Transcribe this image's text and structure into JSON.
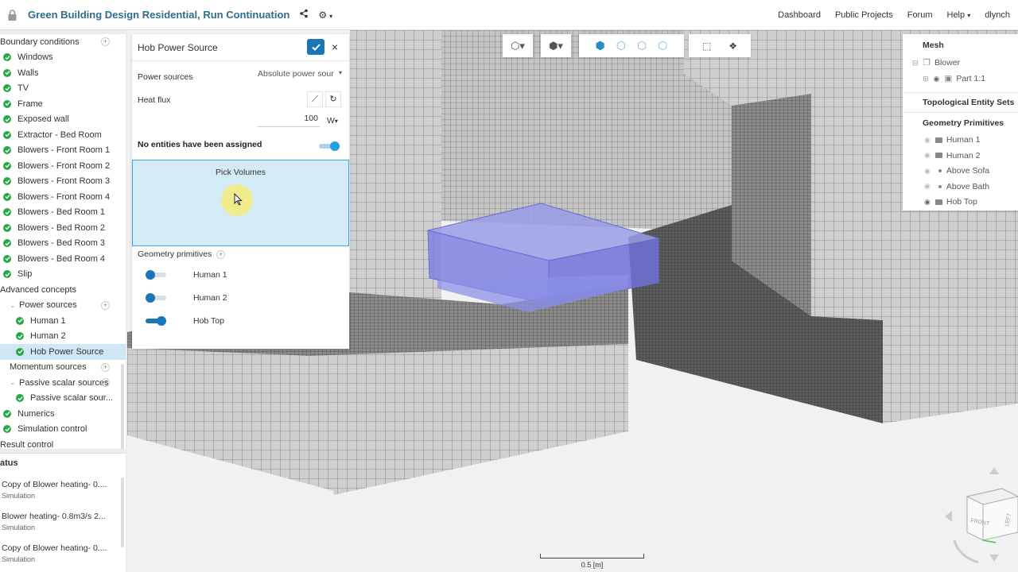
{
  "header": {
    "title": "Green Building Design Residential, Run Continuation",
    "nav": [
      "Dashboard",
      "Public Projects",
      "Forum",
      "Help",
      "dlynch"
    ]
  },
  "tree": [
    {
      "label": "Boundary conditions",
      "level": 0,
      "check": false,
      "plus": true
    },
    {
      "label": "Windows",
      "level": 1,
      "check": true
    },
    {
      "label": "Walls",
      "level": 1,
      "check": true
    },
    {
      "label": "TV",
      "level": 1,
      "check": true
    },
    {
      "label": "Frame",
      "level": 1,
      "check": true
    },
    {
      "label": "Exposed wall",
      "level": 1,
      "check": true
    },
    {
      "label": "Extractor - Bed Room",
      "level": 1,
      "check": true
    },
    {
      "label": "Blowers - Front Room 1",
      "level": 1,
      "check": true
    },
    {
      "label": "Blowers - Front Room 2",
      "level": 1,
      "check": true
    },
    {
      "label": "Blowers - Front Room 3",
      "level": 1,
      "check": true
    },
    {
      "label": "Blowers - Front Room 4",
      "level": 1,
      "check": true
    },
    {
      "label": "Blowers - Bed Room 1",
      "level": 1,
      "check": true
    },
    {
      "label": "Blowers - Bed Room 2",
      "level": 1,
      "check": true
    },
    {
      "label": "Blowers - Bed Room 3",
      "level": 1,
      "check": true
    },
    {
      "label": "Blowers - Bed Room 4",
      "level": 1,
      "check": true
    },
    {
      "label": "Slip",
      "level": 1,
      "check": true
    },
    {
      "label": "Advanced concepts",
      "level": 0,
      "check": false
    },
    {
      "label": "Power sources",
      "level": 2,
      "check": false,
      "plus": true,
      "expander": true
    },
    {
      "label": "Human 1",
      "level": 3,
      "check": true
    },
    {
      "label": "Human 2",
      "level": 3,
      "check": true
    },
    {
      "label": "Hob Power Source",
      "level": 3,
      "check": true,
      "selected": true
    },
    {
      "label": "Momentum sources",
      "level": 2,
      "check": false,
      "plus": true
    },
    {
      "label": "Passive scalar sources",
      "level": 2,
      "check": false,
      "plus": true,
      "expander": true
    },
    {
      "label": "Passive scalar sour...",
      "level": 3,
      "check": true
    },
    {
      "label": "Numerics",
      "level": 1,
      "check": true
    },
    {
      "label": "Simulation control",
      "level": 1,
      "check": true
    },
    {
      "label": "Result control",
      "level": 0,
      "check": false
    }
  ],
  "status": {
    "title": "atus",
    "jobs": [
      {
        "name": "Copy of Blower heating- 0....",
        "type": "Simulation"
      },
      {
        "name": "Blower heating- 0.8m3/s 2...",
        "type": "Simulation"
      },
      {
        "name": "Copy of Blower heating- 0....",
        "type": "Simulation"
      }
    ]
  },
  "panel": {
    "title": "Hob Power Source",
    "power_sources_label": "Power sources",
    "power_sources_value": "Absolute power sour",
    "heat_flux_label": "Heat flux",
    "heat_flux_value": "100",
    "heat_flux_unit": "W",
    "assignment_label": "No entities have been assigned",
    "assignment_toggle_on": true,
    "pick_label": "Pick Volumes",
    "geometry_primitives_label": "Geometry primitives",
    "primitives": [
      {
        "label": "Human 1",
        "on": false
      },
      {
        "label": "Human 2",
        "on": false
      },
      {
        "label": "Hob Top",
        "on": true
      }
    ]
  },
  "right_panel": {
    "mesh_title": "Mesh",
    "mesh_items": [
      {
        "label": "Blower"
      },
      {
        "label": "Part 1:1"
      }
    ],
    "topo_title": "Topological Entity Sets",
    "geo_title": "Geometry Primitives",
    "geo_items": [
      {
        "label": "Human 1",
        "shape": "box",
        "visible": false
      },
      {
        "label": "Human 2",
        "shape": "box",
        "visible": false
      },
      {
        "label": "Above Sofa",
        "shape": "point",
        "visible": false
      },
      {
        "label": "Above Bath",
        "shape": "point",
        "visible": false
      },
      {
        "label": "Hob Top",
        "shape": "box",
        "visible": true
      }
    ]
  },
  "viewport": {
    "scale_label": "0.5 [m]",
    "cube_labels": [
      "FRONT",
      "LEFT"
    ]
  },
  "colors": {
    "brand": "#2f6d8c",
    "accent": "#1976b9",
    "check": "#27a844",
    "highlight_volume": "#7b7fe0",
    "mesh_face": "#c7c7c7"
  }
}
